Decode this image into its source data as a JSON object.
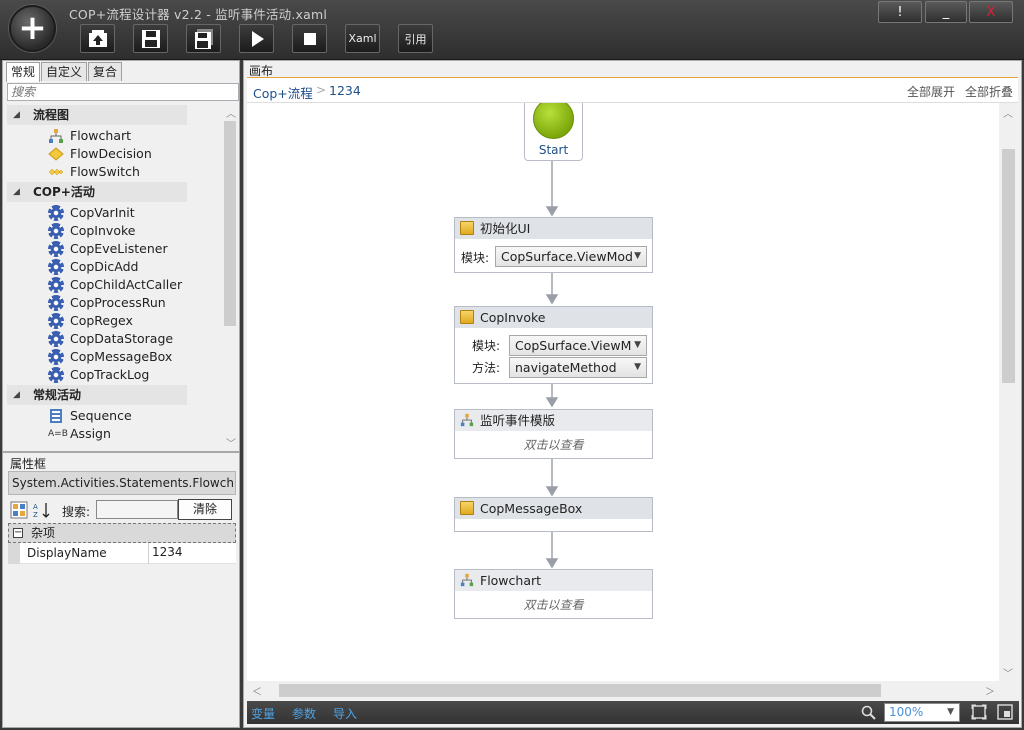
{
  "window": {
    "title": "COP+流程设计器  v2.2  - 监听事件活动.xaml",
    "btn_info": "!",
    "btn_min": "_",
    "btn_close": "X"
  },
  "toolbar": {
    "xaml_label": "Xaml",
    "ref_label": "引用"
  },
  "left": {
    "tabs": [
      "常规",
      "自定义",
      "复合"
    ],
    "search_placeholder": "搜索",
    "categories": [
      {
        "label": "流程图",
        "items": [
          "Flowchart",
          "FlowDecision",
          "FlowSwitch"
        ]
      },
      {
        "label": "COP+活动",
        "items": [
          "CopVarInit",
          "CopInvoke",
          "CopEveListener",
          "CopDicAdd",
          "CopChildActCaller",
          "CopProcessRun",
          "CopRegex",
          "CopDataStorage",
          "CopMessageBox",
          "CopTrackLog"
        ]
      },
      {
        "label": "常规活动",
        "items": [
          "Sequence",
          "Assign"
        ]
      }
    ]
  },
  "properties": {
    "title": "属性框",
    "type_name": "System.Activities.Statements.Flowch...",
    "search_label": "搜索:",
    "clear_label": "清除",
    "category": "杂项",
    "category_toggle": "−",
    "rows": [
      {
        "name": "DisplayName",
        "value": "1234"
      }
    ]
  },
  "canvas": {
    "label": "画布",
    "breadcrumb_root": "Cop+流程",
    "breadcrumb_sep": ">",
    "breadcrumb_current": "1234",
    "expand_all": "全部展开",
    "collapse_all": "全部折叠"
  },
  "flow": {
    "start_label": "Start",
    "nodes": [
      {
        "title": "初始化UI",
        "fields": [
          {
            "label": "模块:",
            "value": "CopSurface.ViewMod"
          }
        ]
      },
      {
        "title": "CopInvoke",
        "fields": [
          {
            "label": "模块:",
            "value": "CopSurface.ViewM"
          },
          {
            "label": "方法:",
            "value": "navigateMethod"
          }
        ]
      },
      {
        "title": "监听事件模版",
        "hint": "双击以查看"
      },
      {
        "title": "CopMessageBox"
      },
      {
        "title": "Flowchart",
        "hint": "双击以查看"
      }
    ]
  },
  "bottom": {
    "variables": "变量",
    "arguments": "参数",
    "imports": "导入",
    "zoom": "100%"
  },
  "colors": {
    "accent": "#1f4f8a",
    "link_blue": "#4ea3e6",
    "start_green": "#8ab512",
    "toolbar_dark": "#2e2e2e"
  }
}
